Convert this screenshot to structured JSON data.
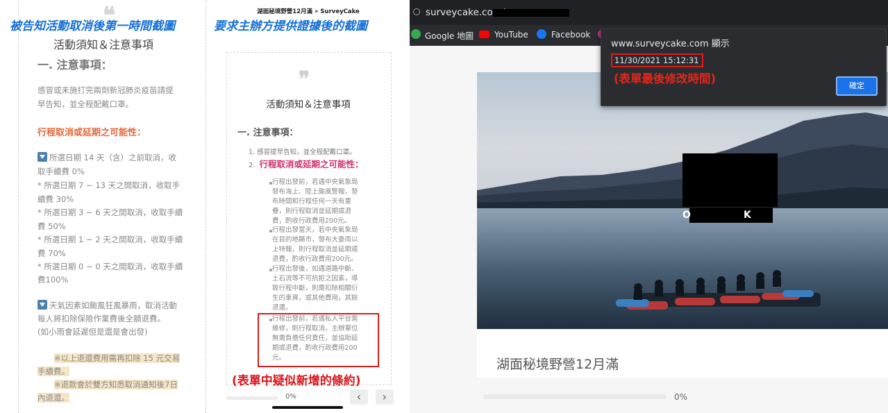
{
  "panel1": {
    "caption": "被告知活動取消後第一時間截圖",
    "heading": "活動須知＆注意事項",
    "subheading": "一. 注意事項：",
    "intro": [
      "感冒或未施打完兩劑新冠肺炎疫苗請提",
      "早告知，並全程配戴口罩。"
    ],
    "orange_heading": "行程取消或延期之可能性：",
    "refund_lines": [
      "所選日期 14 天（含）之前取消，收",
      "取手續費 0%",
      "* 所選日期 7 ~ 13 天之間取消，收取手",
      "續費 30%",
      "* 所選日期 3 ~ 6 天之間取消，收取手續",
      "費 50%",
      "* 所選日期 1 ~ 2 天之間取消，收取手續",
      "費 70%",
      "* 所選日期 0 ~ 0 天之間取消，收取手續",
      "費100%"
    ],
    "weather_lines": [
      "天氣因素如颱風狂風暴雨，取消活動",
      "每人將扣除保險作業費後全額退費。",
      "(如小雨會延遲但是還是會出發)"
    ],
    "highlight_lines": [
      "※以上退還費用需再扣除 15 元交易",
      "手續費。",
      "※退款會於雙方知悉取消通知後7日",
      "內退還。"
    ]
  },
  "panel2": {
    "page_title": "湖面秘境野營12月滿 » SurveyCake",
    "caption": "要求主辦方提供證據後的截圖",
    "heading": "活動須知＆注意事項",
    "subheading": "一. 注意事項：",
    "item1": "1.  感冒提早告知，並全程配戴口罩。",
    "item2_num": "2.",
    "item2": "行程取消或延期之可能性：",
    "bullets": [
      [
        "行程出發前，若遇中央氣象局",
        "發布海上、陸上颱風警報，發",
        "布時間和行程任何一天有重",
        "疊，則行程取消並延期或退",
        "費，酌收行政費用200元。"
      ],
      [
        "行程出發當天，若中央氣象局",
        "在目的地縣市，發布大豪雨以",
        "上特報，則行程取消並延期或",
        "退費，酌收行政費用200元。"
      ],
      [
        "行程出發後，如遇道路中斷、",
        "土石流等不可抗拒之因素，導",
        "致行程中斷，則需扣除相關衍",
        "生的車資，或其他費用，其餘",
        "退還。"
      ],
      [
        "行程出發前，若遇私人平台需",
        "維修，則行程取消，主辦單位",
        "無需負擔任何責任，並協助延",
        "期或退費，酌收行政費用200",
        "元。"
      ]
    ],
    "red_caption": "(表單中疑似新增的條約)",
    "progress": "0%",
    "prev_icon": "‹",
    "next_icon": "›"
  },
  "panel3": {
    "url": "surveycake.com/",
    "bookmarks": [
      "Google 地圖",
      "YouTube",
      "Facebook"
    ],
    "dialog_title": "www.surveycake.com 顯示",
    "dialog_message": "11/30/2021 15:12:31",
    "dialog_note": "(表單最後修改時間)",
    "dialog_ok": "確定",
    "redacted_letters": [
      "O",
      "K"
    ],
    "form_title": "湖面秘境野營12月滿",
    "progress": "0%",
    "progress_value": 0
  }
}
